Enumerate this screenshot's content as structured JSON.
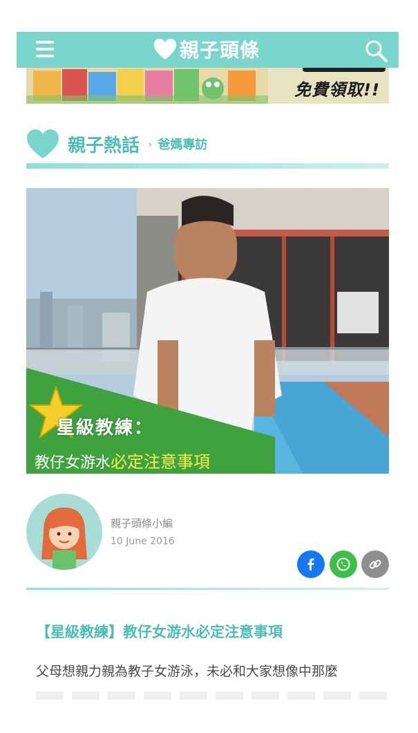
{
  "header": {
    "logo_text": "親子頭條",
    "icons": {
      "menu": "menu-icon",
      "logo": "heart-logo-icon",
      "search": "search-icon"
    },
    "color": "#7ad6cd"
  },
  "banner": {
    "text": "免費領取!!"
  },
  "section": {
    "title": "親子熱話",
    "separator": "›",
    "breadcrumb": "爸媽專訪"
  },
  "hero": {
    "line1": "星級教練：",
    "line2_prefix": "教仔女游水",
    "line2_highlight": "必定注意事項",
    "icon": "star-icon"
  },
  "author": {
    "name": "親子頭條小編",
    "date": "10 June 2016",
    "avatar": "avatar"
  },
  "share": {
    "icons": [
      "facebook-icon",
      "whatsapp-icon",
      "link-icon"
    ]
  },
  "article": {
    "title": "【星級教練】教仔女游水必定注意事項",
    "body": "父母想親力親為教子女游泳，未必和大家想像中那麼"
  },
  "colors": {
    "accent": "#4cbdb3",
    "facebook": "#1877f2",
    "whatsapp": "#3fbf4a",
    "link": "#8f8f8f"
  }
}
